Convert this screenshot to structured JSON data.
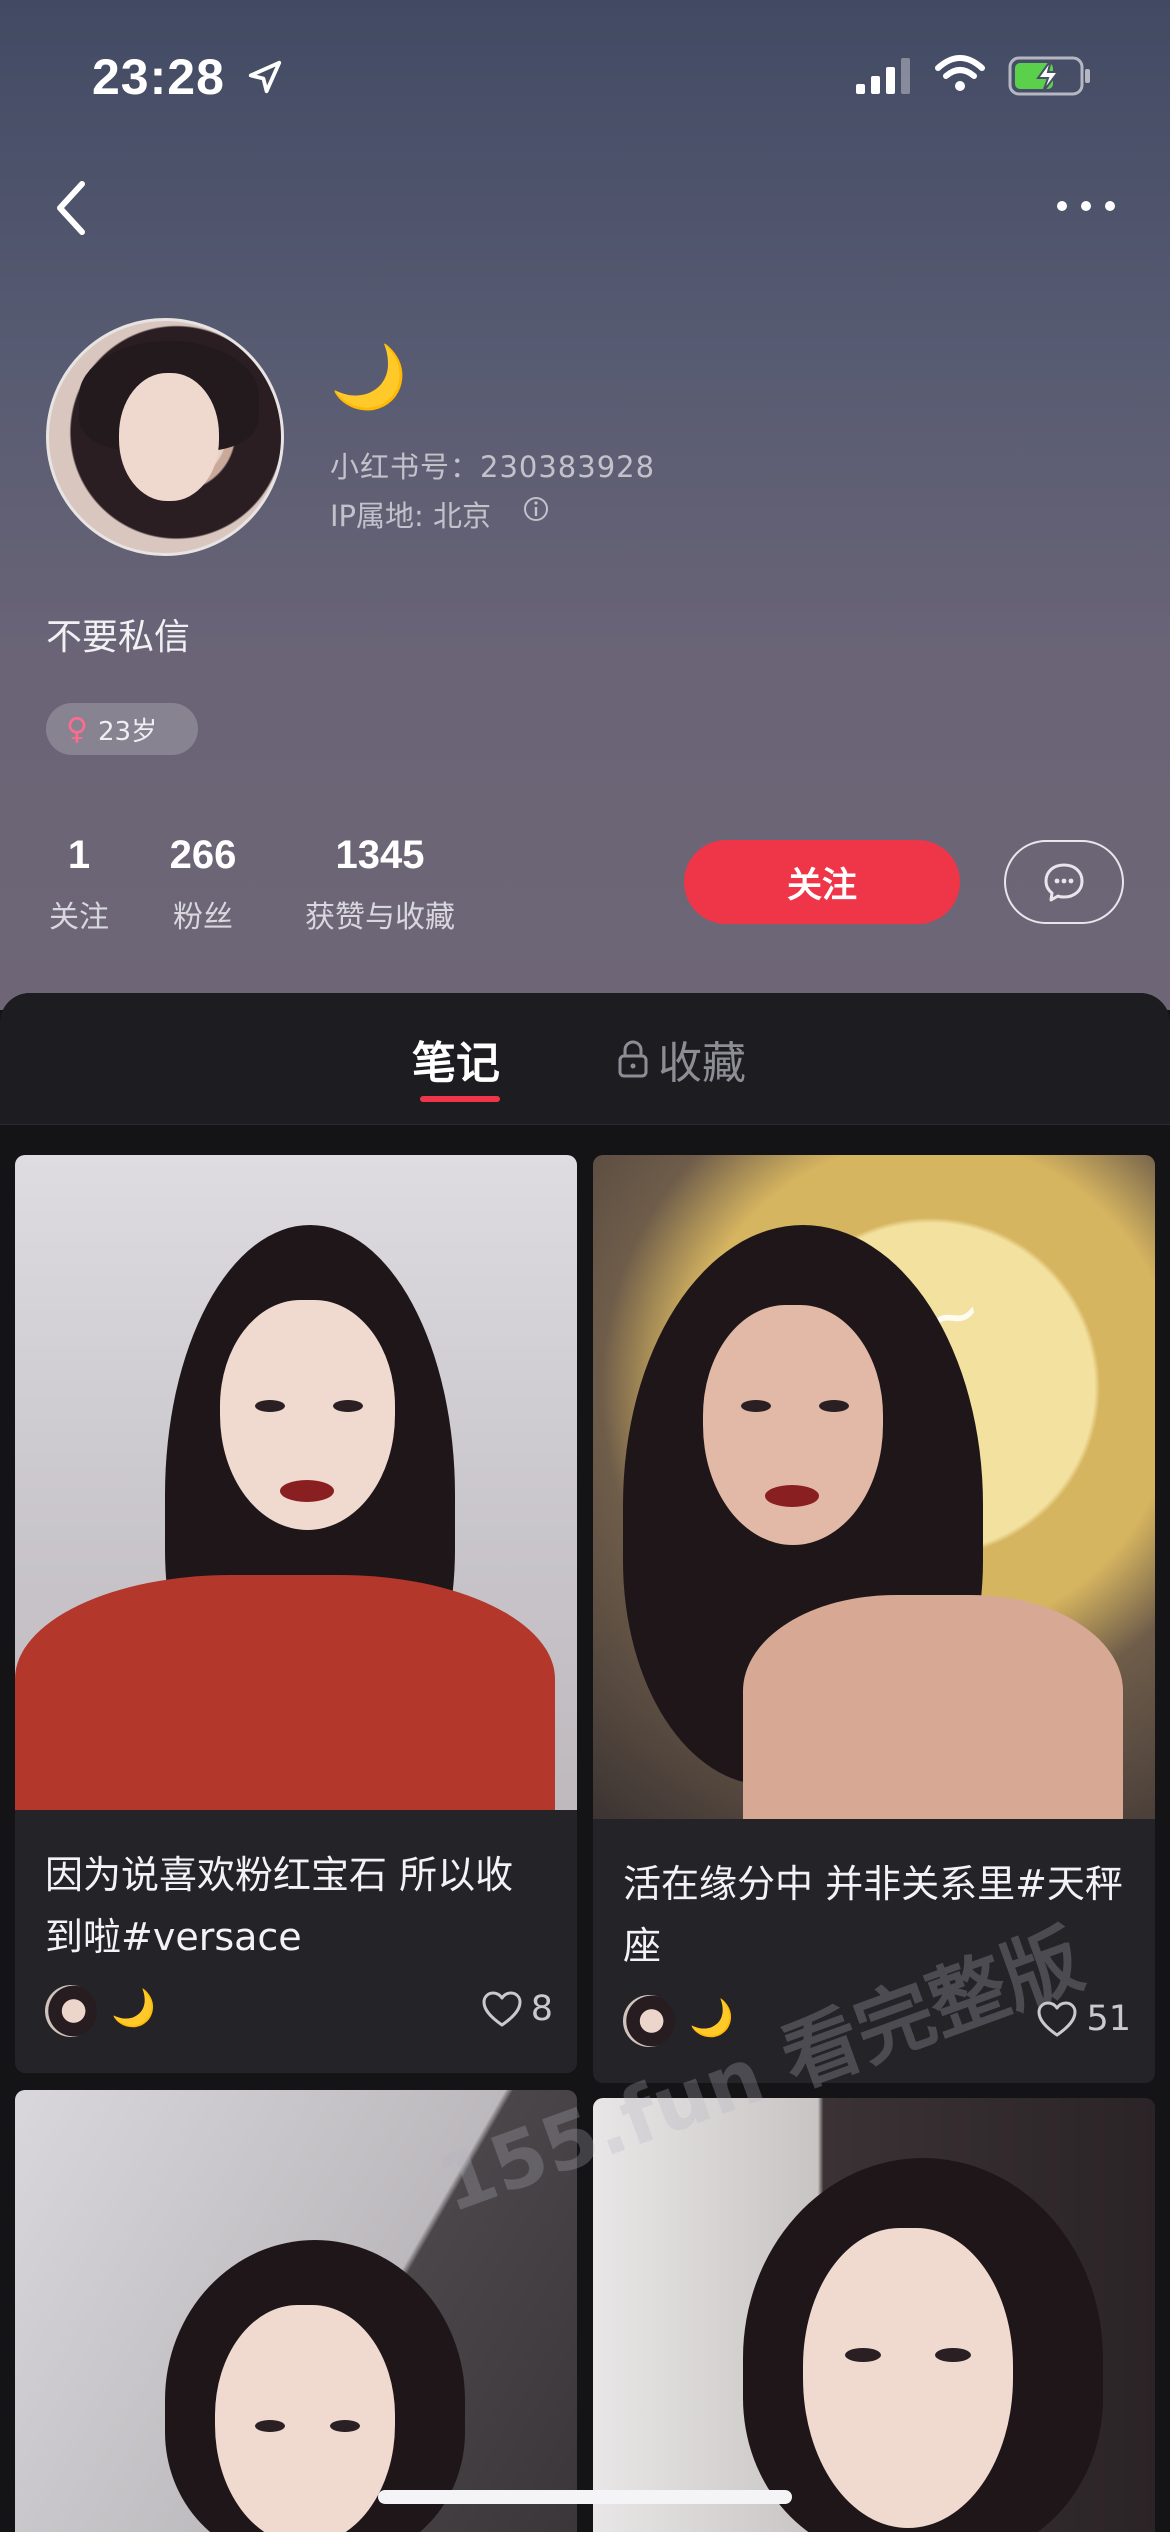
{
  "status_bar": {
    "time": "23:28"
  },
  "profile": {
    "nickname": "🌙",
    "id_label": "小红书号：230383928",
    "ip_label": "IP属地: 北京",
    "bio": "不要私信",
    "age_badge": "23岁",
    "gender_symbol": "♀"
  },
  "stats": [
    {
      "value": "1",
      "label": "关注"
    },
    {
      "value": "266",
      "label": "粉丝"
    },
    {
      "value": "1345",
      "label": "获赞与收藏"
    }
  ],
  "actions": {
    "follow_label": "关注"
  },
  "tabs": {
    "notes": "笔记",
    "favorites": "收藏"
  },
  "notes": [
    {
      "title": "因为说喜欢粉红宝石 所以收到啦#versace",
      "author": "🌙",
      "likes": "8"
    },
    {
      "title": "活在缘分中 并非关系里#天秤座",
      "author": "🌙",
      "likes": "51"
    }
  ],
  "watermark": "155.fun 看完整版",
  "colors": {
    "accent": "#ef3548"
  },
  "icons": [
    "back-icon",
    "more-icon",
    "location-arrow-icon",
    "signal-icon",
    "wifi-icon",
    "battery-charging-icon",
    "info-icon",
    "chat-icon",
    "lock-icon",
    "heart-icon"
  ]
}
